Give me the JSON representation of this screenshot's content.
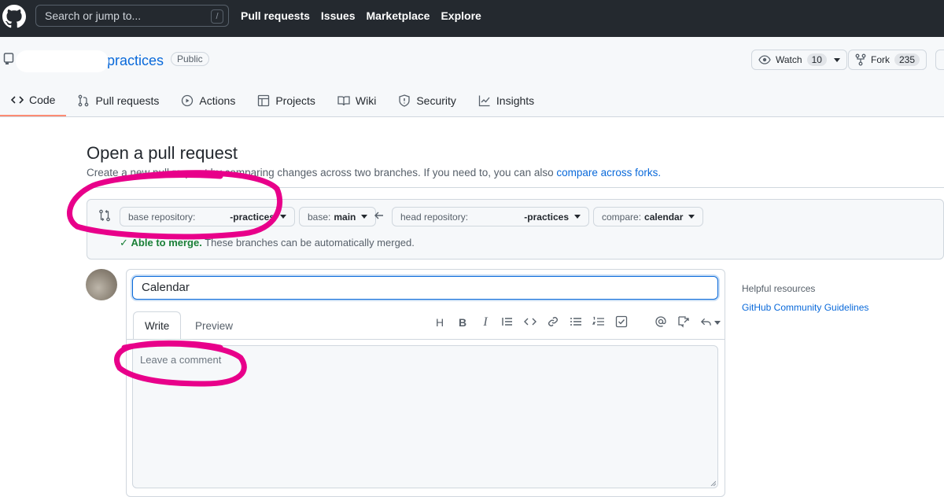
{
  "header": {
    "search_placeholder": "Search or jump to...",
    "search_shortcut": "/",
    "nav": [
      "Pull requests",
      "Issues",
      "Marketplace",
      "Explore"
    ]
  },
  "repo": {
    "name": "practices",
    "visibility": "Public",
    "watch_label": "Watch",
    "watch_count": "10",
    "fork_label": "Fork",
    "fork_count": "235"
  },
  "tabs": [
    {
      "label": "Code",
      "icon": "code-icon",
      "active": true
    },
    {
      "label": "Pull requests",
      "icon": "git-pull-request-icon"
    },
    {
      "label": "Actions",
      "icon": "play-icon"
    },
    {
      "label": "Projects",
      "icon": "table-icon"
    },
    {
      "label": "Wiki",
      "icon": "book-icon"
    },
    {
      "label": "Security",
      "icon": "shield-icon"
    },
    {
      "label": "Insights",
      "icon": "graph-icon"
    }
  ],
  "page": {
    "title": "Open a pull request",
    "subtitle": "Create a new pull request by comparing changes across two branches. If you need to, you can also",
    "subtitle_link": "compare across forks."
  },
  "compare": {
    "base_repo_label": "base repository:",
    "base_repo_value": "-practices",
    "base_label": "base:",
    "base_value": "main",
    "head_repo_label": "head repository:",
    "head_repo_value": "-practices",
    "compare_label": "compare:",
    "compare_value": "calendar",
    "merge_status": "Able to merge.",
    "merge_detail": "These branches can be automatically merged."
  },
  "form": {
    "title_value": "Calendar",
    "write_tab": "Write",
    "preview_tab": "Preview",
    "toolbar": [
      "H",
      "B",
      "I"
    ],
    "comment_placeholder": "Leave a comment"
  },
  "sidebar": {
    "help_title": "Helpful resources",
    "help_link": "GitHub Community Guidelines"
  },
  "colors": {
    "header_bg": "#24292f",
    "link": "#0969da",
    "success": "#1a7f37",
    "annotation": "#e8008a",
    "tab_underline": "#fd8c73"
  }
}
